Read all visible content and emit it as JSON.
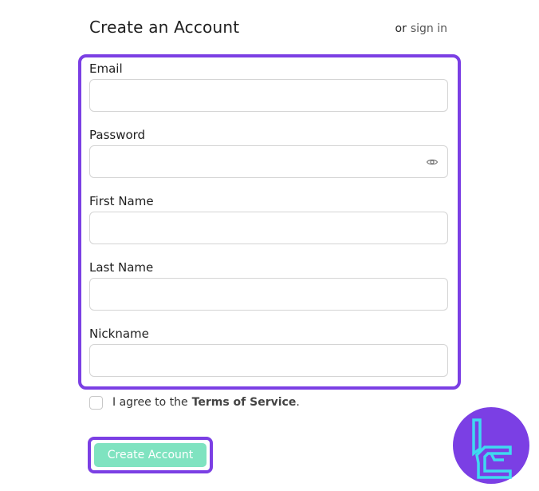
{
  "header": {
    "title": "Create an Account",
    "or_text": "or",
    "signin_label": "sign in"
  },
  "form": {
    "fields": [
      {
        "label": "Email",
        "value": "",
        "placeholder": ""
      },
      {
        "label": "Password",
        "value": "",
        "placeholder": ""
      },
      {
        "label": "First Name",
        "value": "",
        "placeholder": ""
      },
      {
        "label": "Last Name",
        "value": "",
        "placeholder": ""
      },
      {
        "label": "Nickname",
        "value": "",
        "placeholder": ""
      }
    ],
    "password_toggle_icon": "eye-icon"
  },
  "agreement": {
    "text": "I agree to the",
    "link_label": "Terms of Service",
    "suffix": ".",
    "checked": false
  },
  "submit": {
    "label": "Create Account"
  },
  "colors": {
    "highlight": "#7b3fe4",
    "button": "#7fe3c0",
    "logo_bg": "#7b3fe4",
    "logo_fg": "#3fd9f0"
  },
  "logo": {
    "icon": "tradingfinder-logo-icon"
  }
}
